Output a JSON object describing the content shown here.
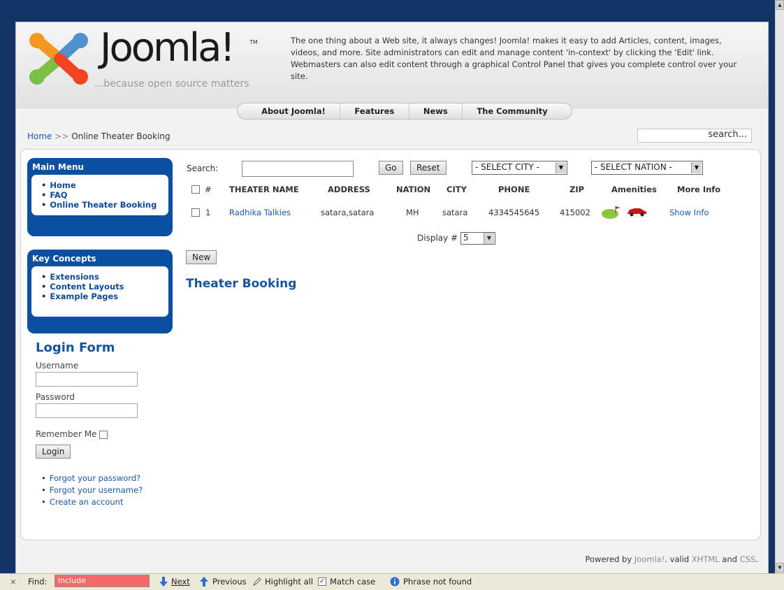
{
  "header": {
    "logo_word": "Joomla!",
    "logo_tm": "TM",
    "logo_tagline": "...because open source matters",
    "intro_text": "The one thing about a Web site, it always changes! Joomla! makes it easy to add Articles, content, images, videos, and more. Site administrators can edit and manage content 'in-context' by clicking the 'Edit' link. Webmasters can also edit content through a graphical Control Panel that gives you complete control over your site."
  },
  "topnav": [
    "About Joomla!",
    "Features",
    "News",
    "The Community"
  ],
  "breadcrumb": {
    "home": "Home",
    "separator": ">>",
    "current": "Online Theater Booking"
  },
  "site_search": {
    "value": "search..."
  },
  "main_menu": {
    "title": "Main Menu",
    "items": [
      "Home",
      "FAQ",
      "Online Theater Booking"
    ]
  },
  "key_concepts": {
    "title": "Key Concepts",
    "items": [
      "Extensions",
      "Content Layouts",
      "Example Pages"
    ]
  },
  "login": {
    "title": "Login Form",
    "username_label": "Username",
    "password_label": "Password",
    "remember_label": "Remember Me",
    "button": "Login",
    "links": [
      "Forgot your password?",
      "Forgot your username?",
      "Create an account"
    ]
  },
  "filter": {
    "label": "Search:",
    "go": "Go",
    "reset": "Reset",
    "city_select": "- SELECT CITY -",
    "nation_select": "- SELECT NATION -"
  },
  "table": {
    "headers": [
      "#",
      "THEATER NAME",
      "ADDRESS",
      "NATION",
      "CITY",
      "PHONE",
      "ZIP",
      "Amenities",
      "More Info"
    ],
    "rows": [
      {
        "num": "1",
        "name": "Radhika Talkies",
        "address": "satara,satara",
        "nation": "MH",
        "city": "satara",
        "phone": "4334545645",
        "zip": "415002",
        "more": "Show Info"
      }
    ]
  },
  "display": {
    "label": "Display #",
    "value": "5"
  },
  "new_button": "New",
  "section_title": "Theater Booking",
  "footer": {
    "powered": "Powered by",
    "joomla": "Joomla!",
    "valid": ". valid",
    "xhtml": "XHTML",
    "and": "and",
    "css": "CSS",
    "end": "."
  },
  "findbar": {
    "close": "×",
    "label": "Find:",
    "value": "include",
    "next": "Next",
    "previous": "Previous",
    "highlight": "Highlight all",
    "match_case": "Match case",
    "status": "Phrase not found"
  }
}
